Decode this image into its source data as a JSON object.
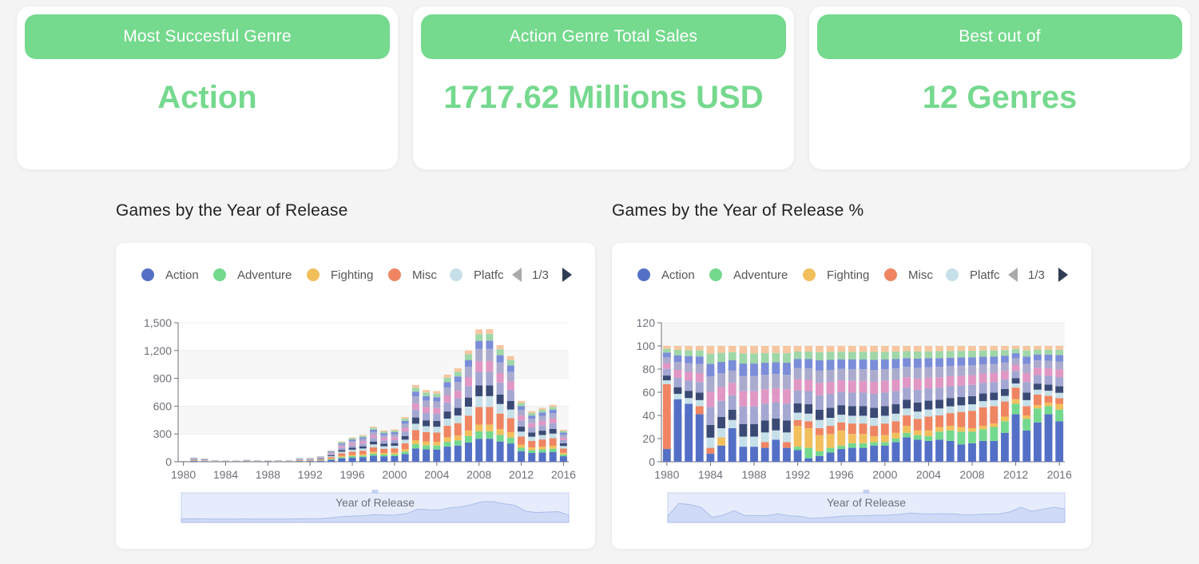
{
  "colors": {
    "accent": "#75d98e",
    "palette": [
      "#5470c6",
      "#74d98f",
      "#f2bf5d",
      "#ef8562",
      "#c6e0e9",
      "#3b4a75",
      "#a3a7d1",
      "#e197c4",
      "#ababce",
      "#7b8dd9",
      "#9fd7a8",
      "#f6c6a0"
    ]
  },
  "kpis": [
    {
      "header": "Most Succesful Genre",
      "value": "Action"
    },
    {
      "header": "Action Genre Total Sales",
      "value": "1717.62 Millions USD"
    },
    {
      "header": "Best out of",
      "value": "12 Genres"
    }
  ],
  "charts": [
    {
      "title": "Games by the Year of Release"
    },
    {
      "title": "Games by the Year of Release %"
    }
  ],
  "legend": {
    "items": [
      "Action",
      "Adventure",
      "Fighting",
      "Misc",
      "Platfc"
    ],
    "page": "1/3"
  },
  "datazoom_label": "Year of Release",
  "chart_data": [
    {
      "type": "bar",
      "stacked": true,
      "title": "Games by the Year of Release",
      "xlabel": "",
      "ylabel": "",
      "ylim": [
        0,
        1500
      ],
      "yticks": [
        0,
        300,
        600,
        900,
        1200,
        1500
      ],
      "ytick_labels": [
        "0",
        "300",
        "600",
        "900",
        "1,200",
        "1,500"
      ],
      "xtick_labels": [
        "1980",
        "1984",
        "1988",
        "1992",
        "1996",
        "2000",
        "2004",
        "2008",
        "2012",
        "2016"
      ],
      "legend_position": "top",
      "categories": [
        1980,
        1981,
        1982,
        1983,
        1984,
        1985,
        1986,
        1987,
        1988,
        1989,
        1990,
        1991,
        1992,
        1993,
        1994,
        1995,
        1996,
        1997,
        1998,
        1999,
        2000,
        2001,
        2002,
        2003,
        2004,
        2005,
        2006,
        2007,
        2008,
        2009,
        2010,
        2011,
        2012,
        2013,
        2014,
        2015,
        2016
      ],
      "totals": [
        9,
        46,
        36,
        17,
        14,
        14,
        21,
        16,
        15,
        17,
        16,
        41,
        43,
        60,
        121,
        219,
        263,
        289,
        379,
        338,
        349,
        482,
        829,
        775,
        763,
        941,
        1008,
        1202,
        1428,
        1431,
        1259,
        1139,
        657,
        546,
        582,
        614,
        344
      ]
    },
    {
      "type": "bar",
      "stacked": true,
      "normalized": true,
      "title": "Games by the Year of Release %",
      "xlabel": "",
      "ylabel": "",
      "ylim": [
        0,
        120
      ],
      "yticks": [
        0,
        20,
        40,
        60,
        80,
        100,
        120
      ],
      "xtick_labels": [
        "1980",
        "1984",
        "1988",
        "1992",
        "1996",
        "2000",
        "2004",
        "2008",
        "2012",
        "2016"
      ],
      "legend_position": "top",
      "categories": [
        1980,
        1981,
        1982,
        1983,
        1984,
        1985,
        1986,
        1987,
        1988,
        1989,
        1990,
        1991,
        1992,
        1993,
        1994,
        1995,
        1996,
        1997,
        1998,
        1999,
        2000,
        2001,
        2002,
        2003,
        2004,
        2005,
        2006,
        2007,
        2008,
        2009,
        2010,
        2011,
        2012,
        2013,
        2014,
        2015,
        2016
      ],
      "series": [
        {
          "name": "Action",
          "values": [
            11,
            54,
            50,
            41,
            7,
            14,
            29,
            13,
            13,
            12,
            19,
            12,
            10,
            3,
            5,
            8,
            11,
            12,
            12,
            14,
            14,
            17,
            21,
            19,
            18,
            19,
            18,
            15,
            16,
            18,
            18,
            25,
            41,
            27,
            34,
            41,
            35
          ]
        },
        {
          "name": "Adventure",
          "values": [
            0,
            0,
            0,
            0,
            0,
            0,
            0,
            0,
            0,
            0,
            0,
            0,
            3,
            9,
            4,
            4,
            3,
            4,
            4,
            3,
            3,
            3,
            4,
            4,
            4,
            7,
            9,
            11,
            10,
            10,
            12,
            10,
            9,
            10,
            12,
            7,
            10
          ]
        },
        {
          "name": "Fighting",
          "values": [
            0,
            0,
            0,
            0,
            0,
            7,
            0,
            0,
            0,
            0,
            0,
            0,
            18,
            17,
            14,
            12,
            13,
            8,
            8,
            5,
            6,
            5,
            6,
            4,
            5,
            4,
            4,
            4,
            3,
            3,
            3,
            4,
            4,
            3,
            3,
            3,
            5
          ]
        },
        {
          "name": "Misc",
          "values": [
            56,
            0,
            0,
            7,
            5,
            0,
            0,
            0,
            0,
            5,
            0,
            5,
            5,
            6,
            6,
            7,
            7,
            9,
            9,
            9,
            10,
            10,
            9,
            10,
            12,
            10,
            11,
            13,
            15,
            16,
            15,
            13,
            10,
            8,
            9,
            6,
            5
          ]
        }
      ],
      "visible_series_count": 4
    }
  ]
}
